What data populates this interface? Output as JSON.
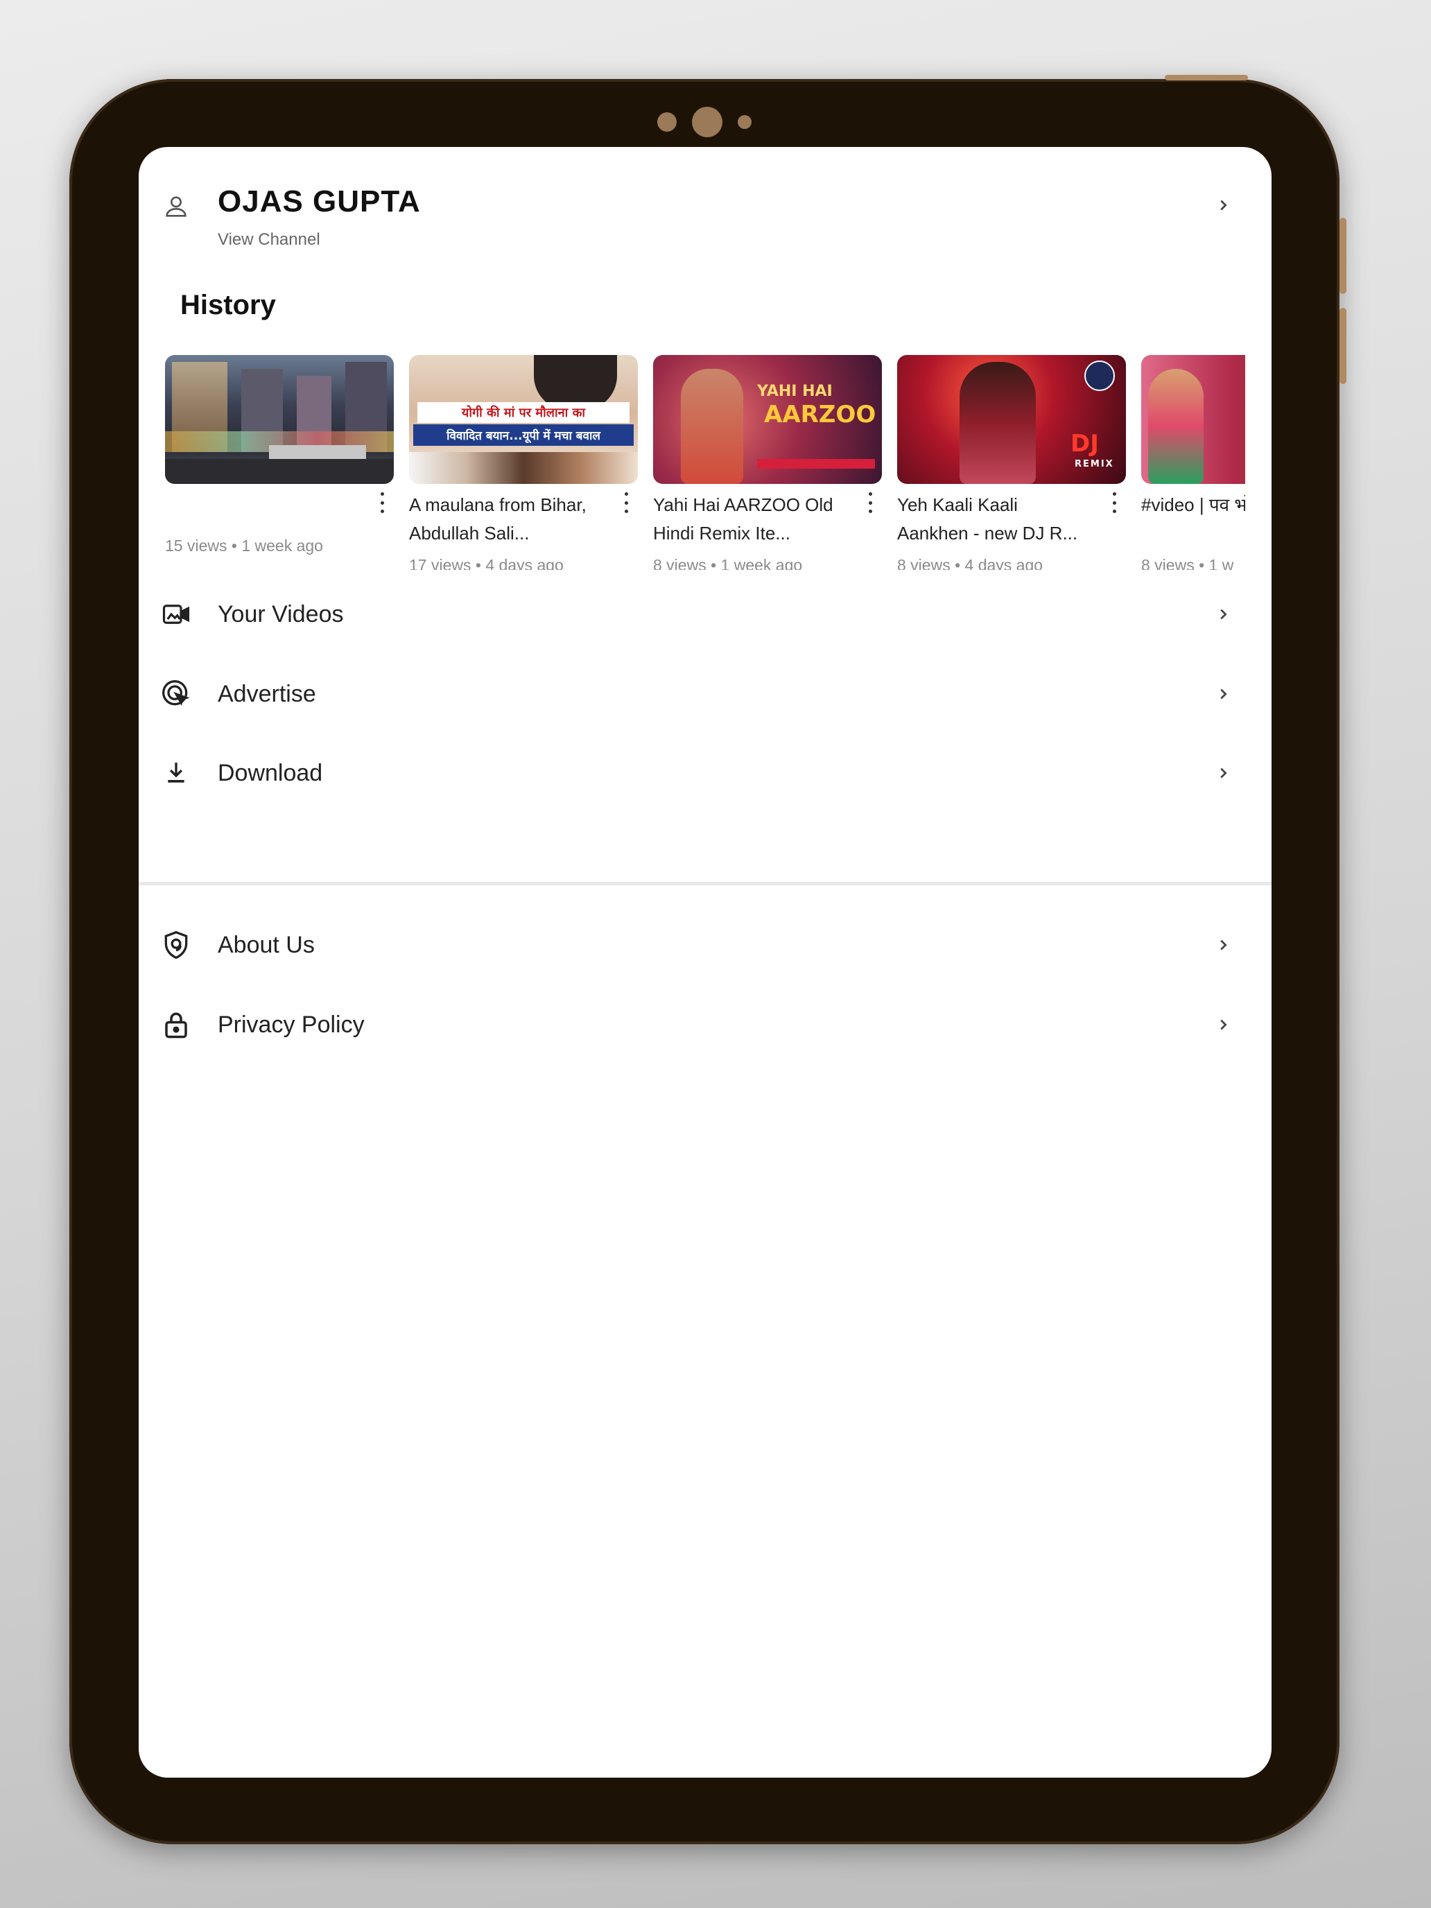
{
  "profile": {
    "name": "OJAS GUPTA",
    "view_channel": "View Channel"
  },
  "history": {
    "title": "History",
    "videos": [
      {
        "title": "",
        "meta": "15 views • 1 week ago"
      },
      {
        "title": "A maulana from Bihar, Abdullah Sali...",
        "meta": "17 views • 4 days ago",
        "overlay_line1": "योगी की मां पर मौलाना का",
        "overlay_line2": "विवादित बयान...यूपी में मचा बवाल"
      },
      {
        "title": "Yahi Hai AARZOO Old Hindi Remix Ite...",
        "meta": "8 views • 1 week ago",
        "overlay_line1": "YAHI HAI",
        "overlay_line2": "AARZOO"
      },
      {
        "title": "Yeh Kaali Kaali Aankhen - new DJ R...",
        "meta": "8 views • 4 days ago",
        "overlay_line1": "DJ",
        "overlay_line2": "REMIX"
      },
      {
        "title": "#video | पव भोजपुरी का स",
        "meta": "8 views • 1 w"
      }
    ]
  },
  "menu": {
    "your_videos": "Your Videos",
    "advertise": "Advertise",
    "download": "Download",
    "about_us": "About Us",
    "privacy_policy": "Privacy Policy"
  },
  "colors": {
    "bezel": "#1d1206",
    "screen": "#ffffff",
    "accent_text": "#222222"
  },
  "icons": [
    "person-icon",
    "video-camera-icon",
    "advertise-icon",
    "download-icon",
    "shield-icon",
    "lock-icon",
    "chevron-right-icon",
    "more-vertical-icon"
  ]
}
